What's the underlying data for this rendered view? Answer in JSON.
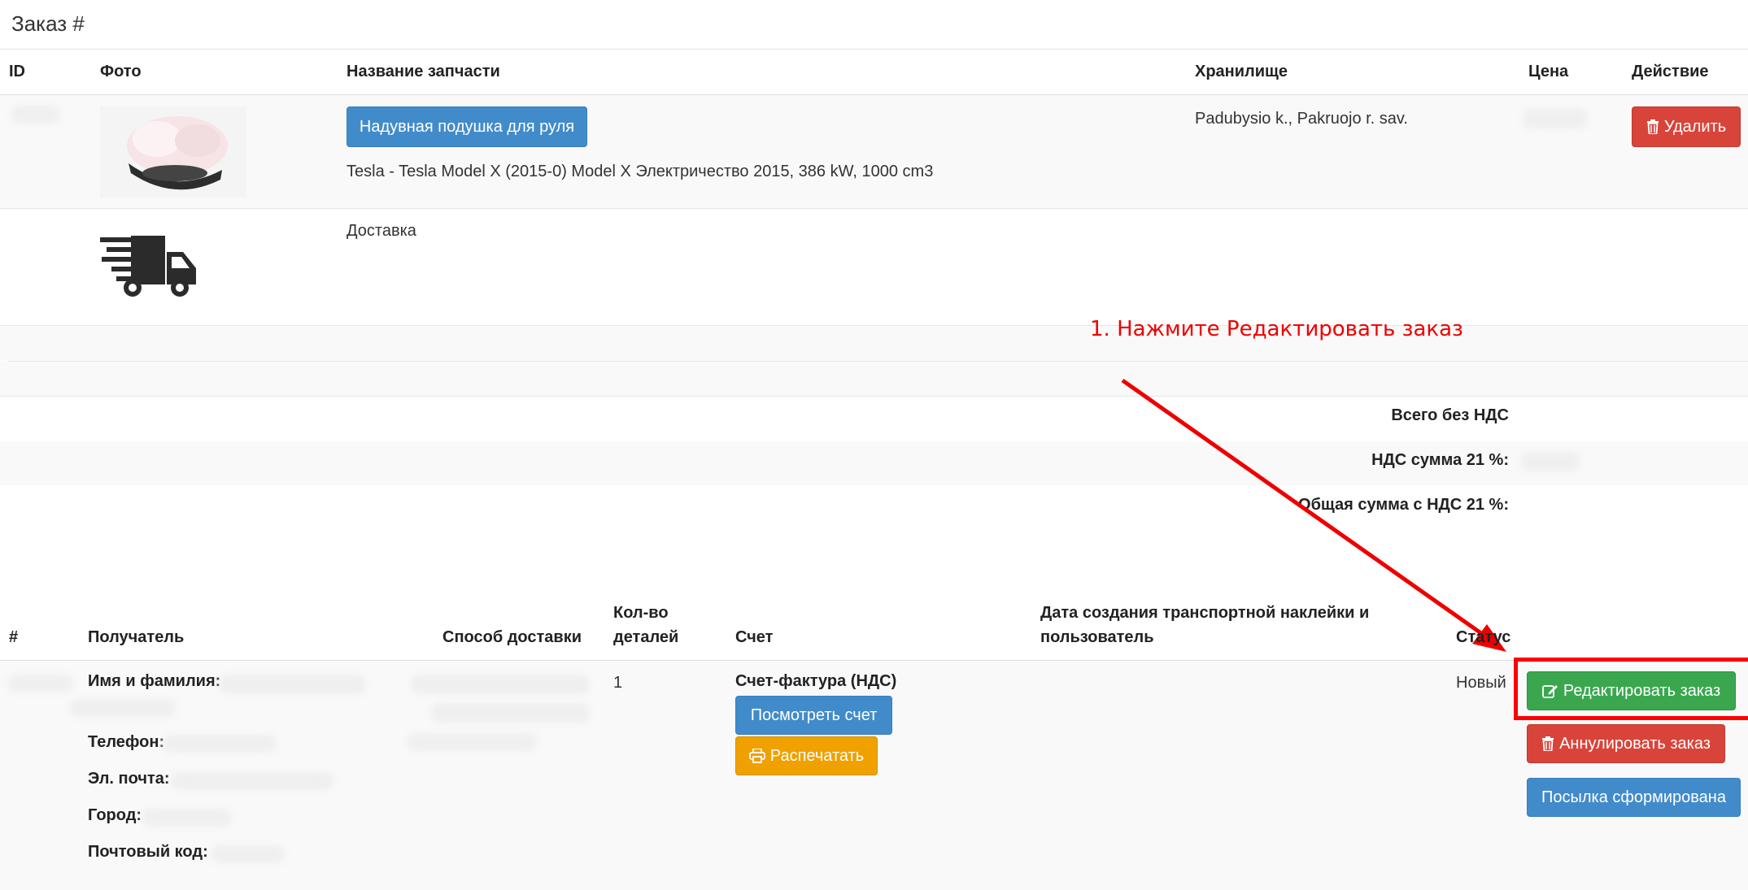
{
  "page": {
    "title": "Заказ #"
  },
  "items_table": {
    "headers": [
      "ID",
      "Фото",
      "Название запчасти",
      "Хранилище",
      "Цена",
      "Действие"
    ],
    "row1": {
      "part_button": "Надувная подушка для руля",
      "vehicle": "Tesla - Tesla Model X (2015-0) Model X Электричество 2015, 386 kW, 1000 cm3",
      "storage": "Padubysio k., Pakruojo r. sav.",
      "delete_label": "Удалить"
    },
    "row2": {
      "name": "Доставка"
    },
    "totals": {
      "net": "Всего без НДС",
      "vat": "НДС сумма 21 %:",
      "gross": "Общая сумма с НДС 21 %:"
    }
  },
  "annotation": {
    "text": "1. Нажмите Редактировать заказ",
    "color": "#ee0000"
  },
  "orders_table": {
    "headers": {
      "num": "#",
      "recipient": "Получатель",
      "delivery": "Способ доставки",
      "qty_line1": "Кол-во",
      "qty_line2": "деталей",
      "invoice": "Счет",
      "label_date_line1": "Дата создания транспортной наклейки и",
      "label_date_line2": "пользователь",
      "status": "Статус"
    },
    "row": {
      "name_label": "Имя и фамилия:",
      "phone_label": "Телефон:",
      "email_label": "Эл. почта:",
      "city_label": "Город:",
      "zip_label": "Почтовый код:",
      "qty": "1",
      "invoice_type": "Счет-фактура (НДС)",
      "view_invoice": "Посмотреть счет",
      "print": "Распечатать",
      "status": "Новый",
      "edit_order": "Редактировать заказ",
      "cancel_order": "Аннулировать заказ",
      "parcel_formed": "Посылка сформирована"
    }
  },
  "colors": {
    "blue": "#428bca",
    "red": "#d9443a",
    "green": "#3aa74f",
    "orange": "#f0a100",
    "highlight": "#ff0000"
  }
}
